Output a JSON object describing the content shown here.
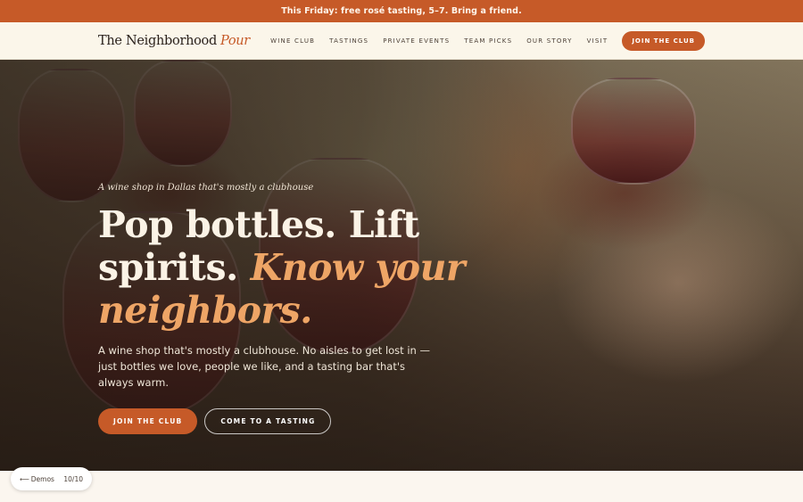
{
  "announcement": "This Friday: free rosé tasting, 5–7. Bring a friend.",
  "nav": {
    "logo_main": "The Neighborhood",
    "logo_accent": "Pour",
    "links": [
      "WINE CLUB",
      "TASTINGS",
      "PRIVATE EVENTS",
      "TEAM PICKS",
      "OUR STORY",
      "VISIT"
    ],
    "cta": "JOIN THE CLUB"
  },
  "hero": {
    "eyebrow": "A wine shop in Dallas that's mostly a clubhouse",
    "headline_plain": "Pop bottles. Lift spirits.",
    "headline_highlight": "Know your neighbors.",
    "lede": "A wine shop that's mostly a clubhouse. No aisles to get lost in — just bottles we love, people we like, and a tasting bar that's always warm.",
    "primary_cta": "JOIN THE CLUB",
    "secondary_cta": "COME TO A TASTING"
  },
  "demo": {
    "back_label": "Demos",
    "back_icon": "arrow-left-icon",
    "counter": "10/10"
  },
  "colors": {
    "accent": "#c65a28",
    "highlight": "#eea566",
    "nav_bg": "#fbf6ea"
  }
}
